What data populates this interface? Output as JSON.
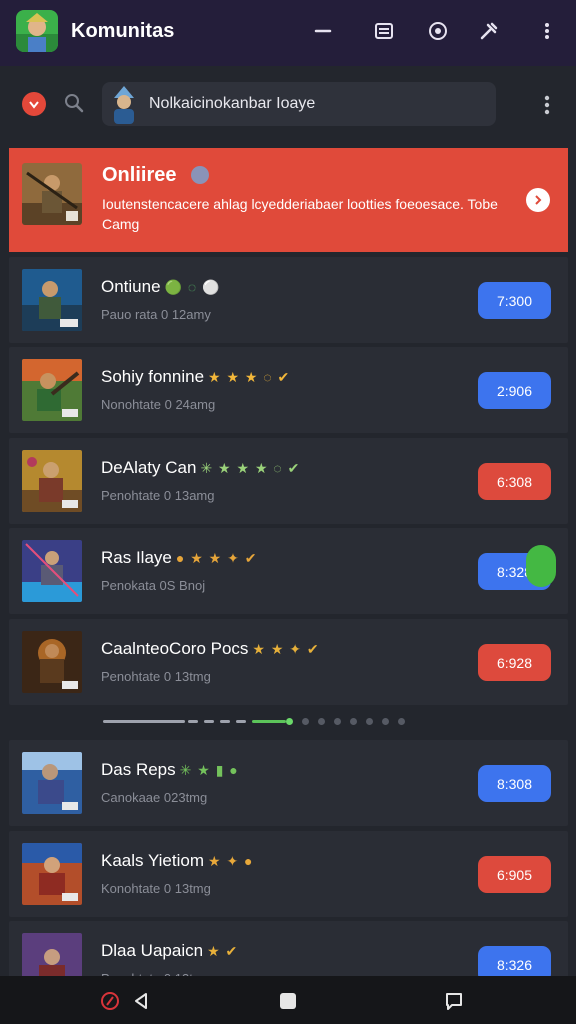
{
  "app": {
    "title": "Komunitas",
    "icons": [
      "minimize-icon",
      "list-icon",
      "record-icon",
      "tools-icon",
      "more-vertical-icon"
    ]
  },
  "search": {
    "value": "Nolkaicinokanbar Ioaye",
    "icons": [
      "brand-icon",
      "search-icon",
      "more-vertical-icon"
    ]
  },
  "banner": {
    "title": "Onliiree",
    "description": "Ioutenstencacere ahlag lcyedderiabaer lootties foeoesace. Tobe Camg",
    "icon": "chevron-right-icon"
  },
  "rows": [
    {
      "title": "Ontiune",
      "badges": "🟢 ◌ ⚪",
      "subtitle": "Pauo rata 0 12amy",
      "button": "7:300",
      "button_color": "blue"
    },
    {
      "title": "Sohiy fonnine",
      "badges": "★ ★ ★ ◌ ✔",
      "subtitle": "Nonohtate 0 24amg",
      "button": "2:906",
      "button_color": "blue"
    },
    {
      "title": "DeAlaty Can",
      "badges": "✳ ★ ★ ★ ◌ ✔",
      "subtitle": "Penohtate 0 13amg",
      "button": "6:308",
      "button_color": "red"
    },
    {
      "title": "Ras Ilaye",
      "badges": "● ★ ★ ✦ ✔",
      "subtitle": "Penokata 0S Bnoj",
      "button": "8:328",
      "button_color": "blue",
      "notification": true
    },
    {
      "title": "CaalnteoCoro Pocs",
      "badges": "★ ★ ✦ ✔",
      "subtitle": "Penohtate 0 13tmg",
      "button": "6:928",
      "button_color": "red"
    },
    {
      "title": "Das Reps",
      "badges": "✳ ★ ▮ ●",
      "subtitle": "Canokaae 023tmg",
      "button": "8:308",
      "button_color": "blue"
    },
    {
      "title": "Kaals Yietiom",
      "badges": "★ ✦ ●",
      "subtitle": "Konohtate 0 13tmg",
      "button": "6:905",
      "button_color": "red"
    },
    {
      "title": "Dlaa Uapaicn",
      "badges": "★ ✔",
      "subtitle": "Penohtate 0 13tmg",
      "button": "8:326",
      "button_color": "blue"
    }
  ],
  "navbar": {
    "icons": [
      "record-icon",
      "back-icon",
      "home-icon",
      "chat-icon"
    ]
  },
  "colors": {
    "topbar": "#241e3a",
    "accent_red": "#e04a3a",
    "accent_blue": "#3d74ee",
    "background": "#23262d"
  }
}
